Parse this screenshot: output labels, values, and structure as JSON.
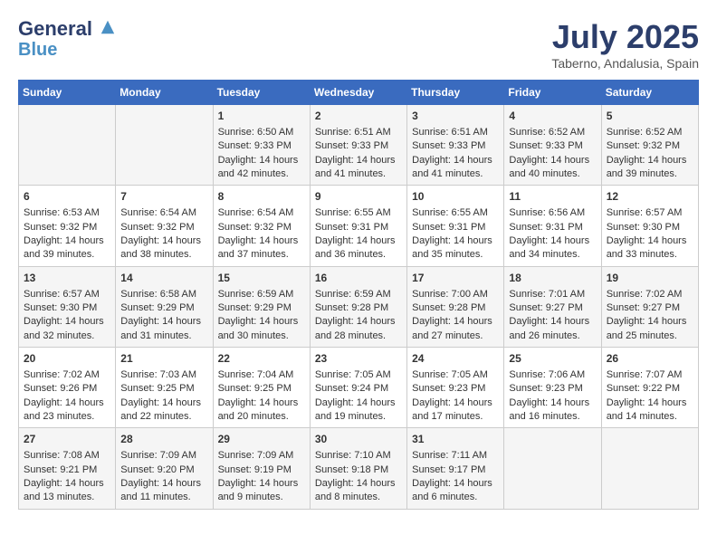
{
  "header": {
    "logo_line1": "General",
    "logo_line2": "Blue",
    "month": "July 2025",
    "location": "Taberno, Andalusia, Spain"
  },
  "weekdays": [
    "Sunday",
    "Monday",
    "Tuesday",
    "Wednesday",
    "Thursday",
    "Friday",
    "Saturday"
  ],
  "weeks": [
    [
      {
        "day": "",
        "sunrise": "",
        "sunset": "",
        "daylight": ""
      },
      {
        "day": "",
        "sunrise": "",
        "sunset": "",
        "daylight": ""
      },
      {
        "day": "1",
        "sunrise": "Sunrise: 6:50 AM",
        "sunset": "Sunset: 9:33 PM",
        "daylight": "Daylight: 14 hours and 42 minutes."
      },
      {
        "day": "2",
        "sunrise": "Sunrise: 6:51 AM",
        "sunset": "Sunset: 9:33 PM",
        "daylight": "Daylight: 14 hours and 41 minutes."
      },
      {
        "day": "3",
        "sunrise": "Sunrise: 6:51 AM",
        "sunset": "Sunset: 9:33 PM",
        "daylight": "Daylight: 14 hours and 41 minutes."
      },
      {
        "day": "4",
        "sunrise": "Sunrise: 6:52 AM",
        "sunset": "Sunset: 9:33 PM",
        "daylight": "Daylight: 14 hours and 40 minutes."
      },
      {
        "day": "5",
        "sunrise": "Sunrise: 6:52 AM",
        "sunset": "Sunset: 9:32 PM",
        "daylight": "Daylight: 14 hours and 39 minutes."
      }
    ],
    [
      {
        "day": "6",
        "sunrise": "Sunrise: 6:53 AM",
        "sunset": "Sunset: 9:32 PM",
        "daylight": "Daylight: 14 hours and 39 minutes."
      },
      {
        "day": "7",
        "sunrise": "Sunrise: 6:54 AM",
        "sunset": "Sunset: 9:32 PM",
        "daylight": "Daylight: 14 hours and 38 minutes."
      },
      {
        "day": "8",
        "sunrise": "Sunrise: 6:54 AM",
        "sunset": "Sunset: 9:32 PM",
        "daylight": "Daylight: 14 hours and 37 minutes."
      },
      {
        "day": "9",
        "sunrise": "Sunrise: 6:55 AM",
        "sunset": "Sunset: 9:31 PM",
        "daylight": "Daylight: 14 hours and 36 minutes."
      },
      {
        "day": "10",
        "sunrise": "Sunrise: 6:55 AM",
        "sunset": "Sunset: 9:31 PM",
        "daylight": "Daylight: 14 hours and 35 minutes."
      },
      {
        "day": "11",
        "sunrise": "Sunrise: 6:56 AM",
        "sunset": "Sunset: 9:31 PM",
        "daylight": "Daylight: 14 hours and 34 minutes."
      },
      {
        "day": "12",
        "sunrise": "Sunrise: 6:57 AM",
        "sunset": "Sunset: 9:30 PM",
        "daylight": "Daylight: 14 hours and 33 minutes."
      }
    ],
    [
      {
        "day": "13",
        "sunrise": "Sunrise: 6:57 AM",
        "sunset": "Sunset: 9:30 PM",
        "daylight": "Daylight: 14 hours and 32 minutes."
      },
      {
        "day": "14",
        "sunrise": "Sunrise: 6:58 AM",
        "sunset": "Sunset: 9:29 PM",
        "daylight": "Daylight: 14 hours and 31 minutes."
      },
      {
        "day": "15",
        "sunrise": "Sunrise: 6:59 AM",
        "sunset": "Sunset: 9:29 PM",
        "daylight": "Daylight: 14 hours and 30 minutes."
      },
      {
        "day": "16",
        "sunrise": "Sunrise: 6:59 AM",
        "sunset": "Sunset: 9:28 PM",
        "daylight": "Daylight: 14 hours and 28 minutes."
      },
      {
        "day": "17",
        "sunrise": "Sunrise: 7:00 AM",
        "sunset": "Sunset: 9:28 PM",
        "daylight": "Daylight: 14 hours and 27 minutes."
      },
      {
        "day": "18",
        "sunrise": "Sunrise: 7:01 AM",
        "sunset": "Sunset: 9:27 PM",
        "daylight": "Daylight: 14 hours and 26 minutes."
      },
      {
        "day": "19",
        "sunrise": "Sunrise: 7:02 AM",
        "sunset": "Sunset: 9:27 PM",
        "daylight": "Daylight: 14 hours and 25 minutes."
      }
    ],
    [
      {
        "day": "20",
        "sunrise": "Sunrise: 7:02 AM",
        "sunset": "Sunset: 9:26 PM",
        "daylight": "Daylight: 14 hours and 23 minutes."
      },
      {
        "day": "21",
        "sunrise": "Sunrise: 7:03 AM",
        "sunset": "Sunset: 9:25 PM",
        "daylight": "Daylight: 14 hours and 22 minutes."
      },
      {
        "day": "22",
        "sunrise": "Sunrise: 7:04 AM",
        "sunset": "Sunset: 9:25 PM",
        "daylight": "Daylight: 14 hours and 20 minutes."
      },
      {
        "day": "23",
        "sunrise": "Sunrise: 7:05 AM",
        "sunset": "Sunset: 9:24 PM",
        "daylight": "Daylight: 14 hours and 19 minutes."
      },
      {
        "day": "24",
        "sunrise": "Sunrise: 7:05 AM",
        "sunset": "Sunset: 9:23 PM",
        "daylight": "Daylight: 14 hours and 17 minutes."
      },
      {
        "day": "25",
        "sunrise": "Sunrise: 7:06 AM",
        "sunset": "Sunset: 9:23 PM",
        "daylight": "Daylight: 14 hours and 16 minutes."
      },
      {
        "day": "26",
        "sunrise": "Sunrise: 7:07 AM",
        "sunset": "Sunset: 9:22 PM",
        "daylight": "Daylight: 14 hours and 14 minutes."
      }
    ],
    [
      {
        "day": "27",
        "sunrise": "Sunrise: 7:08 AM",
        "sunset": "Sunset: 9:21 PM",
        "daylight": "Daylight: 14 hours and 13 minutes."
      },
      {
        "day": "28",
        "sunrise": "Sunrise: 7:09 AM",
        "sunset": "Sunset: 9:20 PM",
        "daylight": "Daylight: 14 hours and 11 minutes."
      },
      {
        "day": "29",
        "sunrise": "Sunrise: 7:09 AM",
        "sunset": "Sunset: 9:19 PM",
        "daylight": "Daylight: 14 hours and 9 minutes."
      },
      {
        "day": "30",
        "sunrise": "Sunrise: 7:10 AM",
        "sunset": "Sunset: 9:18 PM",
        "daylight": "Daylight: 14 hours and 8 minutes."
      },
      {
        "day": "31",
        "sunrise": "Sunrise: 7:11 AM",
        "sunset": "Sunset: 9:17 PM",
        "daylight": "Daylight: 14 hours and 6 minutes."
      },
      {
        "day": "",
        "sunrise": "",
        "sunset": "",
        "daylight": ""
      },
      {
        "day": "",
        "sunrise": "",
        "sunset": "",
        "daylight": ""
      }
    ]
  ]
}
